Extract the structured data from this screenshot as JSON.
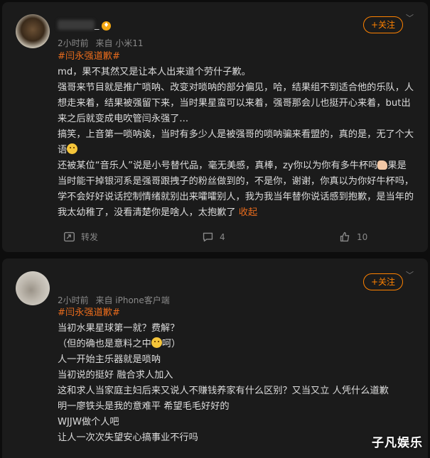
{
  "comments": [
    {
      "time": "2小时前",
      "source": "来自 小米11",
      "follow_label": "+关注",
      "topic": "#闫永强道歉#",
      "lines": [
        "md，果不其然又是让本人出来道个劳什子歉。",
        "强哥来节目就是推广唢呐、改变对唢呐的部分偏见，哈，结果组不到适合他的乐队，人想走来着，结果被强留下来，当时果星蛮可以来着，强哥那会儿也挺开心来着，but出来之后就变成电吹管闫永强了...",
        "搞笑，上音第一唢呐诶，当时有多少人是被强哥的唢呐骗来看盟的，真的是，无了个大语",
        "还被某位“音乐人”说是小号替代品，毫无美感，真棒，zy你以为你有多牛杯吗",
        "果是当时能干掉银河系是强哥跟拽子的粉丝做到的，不是你，谢谢，你真以为你好牛杯吗，学不会好好说话控制情绪就别出来嚯嚯别人，我为我当年替你说话感到抱歉，是当年的我太幼稚了，没看清楚你是啥人，太抱歉了"
      ],
      "collapse_link": "收起",
      "repost_label": "转发",
      "comment_count": "4",
      "like_count": "10"
    },
    {
      "time": "2小时前",
      "source": "来自 iPhone客户端",
      "follow_label": "+关注",
      "topic": "#闫永强道歉#",
      "lines": [
        "当初水果星球第一就？费解？",
        "（但的确也是意料之中",
        "呵）",
        "人一开始主乐器就是唢呐",
        "当初说的挺好 融合求人加入",
        "这和求人当家庭主妇后来又说人不赚钱养家有什么区别？又当又立 人凭什么道歉",
        "明一廖铁头是我的意难平 希望毛毛好好的",
        "WJJW做个人吧",
        "让人一次次失望安心搞事业不行吗"
      ]
    }
  ],
  "watermark": "子凡娱乐",
  "colors": {
    "accent": "#ff8200",
    "topic": "#e86b1c",
    "card": "#1b1b1b",
    "bg": "#0d0d0d"
  }
}
